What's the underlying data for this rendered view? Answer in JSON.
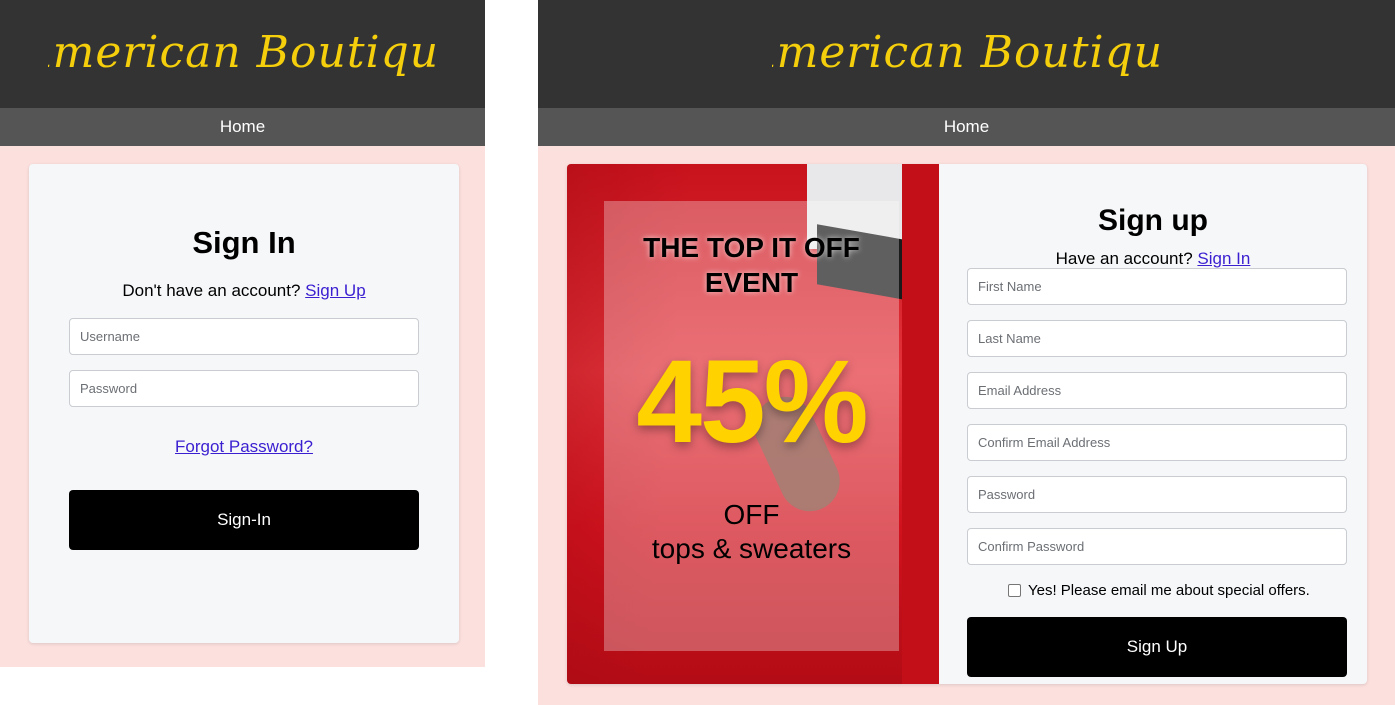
{
  "brand": {
    "logo_text": "American Boutique",
    "logo_color": "#f5cf0c"
  },
  "nav": {
    "home_label": "Home"
  },
  "signin": {
    "title": "Sign In",
    "prompt_text": "Don't have an account?",
    "prompt_link": "Sign Up",
    "username_placeholder": "Username",
    "password_placeholder": "Password",
    "forgot_label": "Forgot Password?",
    "submit_label": "Sign-In"
  },
  "promo": {
    "headline": "THE TOP IT OFF EVENT",
    "percent": "45%",
    "off_line": "OFF",
    "category_line": "tops & sweaters"
  },
  "signup": {
    "title": "Sign up",
    "prompt_text": "Have an account?",
    "prompt_link": "Sign In",
    "fields": [
      {
        "placeholder": "First Name"
      },
      {
        "placeholder": "Last Name"
      },
      {
        "placeholder": "Email Address"
      },
      {
        "placeholder": "Confirm Email Address"
      },
      {
        "placeholder": "Password"
      },
      {
        "placeholder": "Confirm Password"
      }
    ],
    "offers_label": "Yes! Please email me about special offers.",
    "offers_checked": false,
    "submit_label": "Sign Up"
  },
  "colors": {
    "header_bg": "#333333",
    "nav_bg": "#555555",
    "page_bg": "#fbe0de",
    "card_bg": "#f5f7f9",
    "link": "#3a1fd1",
    "promo_yellow": "#ffd200"
  }
}
